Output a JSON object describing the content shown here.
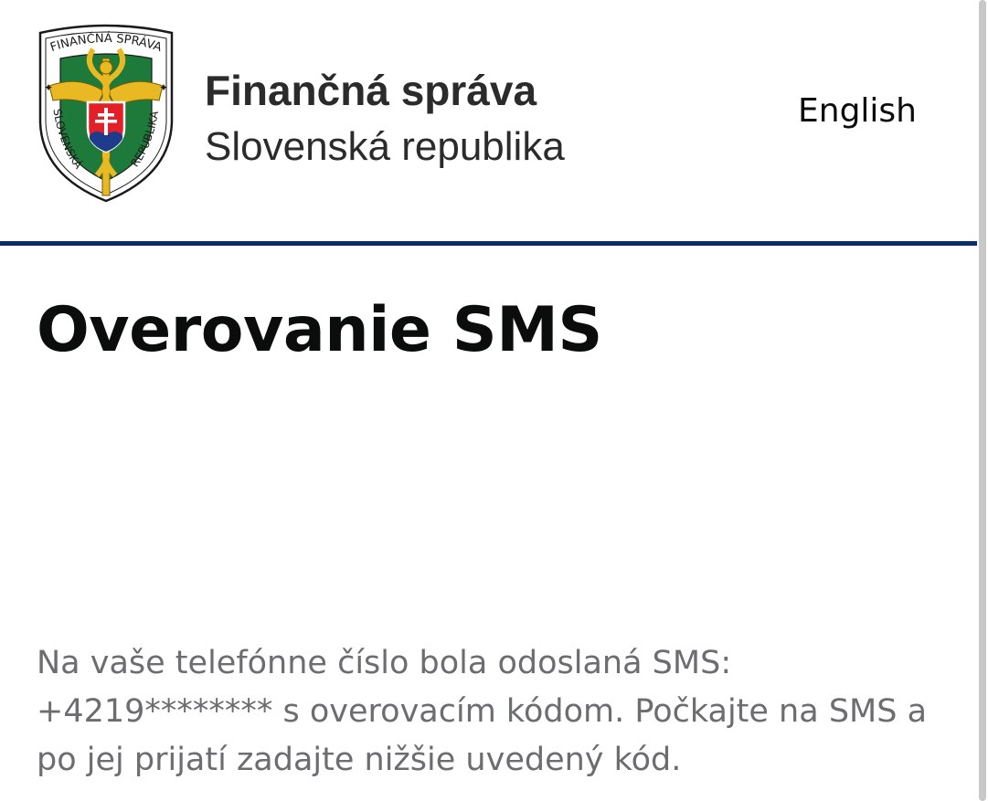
{
  "header": {
    "logo_ring_top": "FINANČNÁ SPRÁVA",
    "logo_ring_left": "SLOVENSKÁ",
    "logo_ring_right": "REPUBLIKA",
    "brand_title": "Finančná správa",
    "brand_subtitle": "Slovenská republika",
    "language_link": "English",
    "accent_color": "#0b2e6b"
  },
  "main": {
    "title": "Overovanie SMS",
    "message": "Na vaše telefónne číslo bola odoslaná SMS: +4219******** s overovacím kódom. Počkajte na SMS a po jej prijatí zadajte nižšie uvedený kód."
  },
  "icons": {
    "logo": "financna-sprava-emblem-icon"
  }
}
